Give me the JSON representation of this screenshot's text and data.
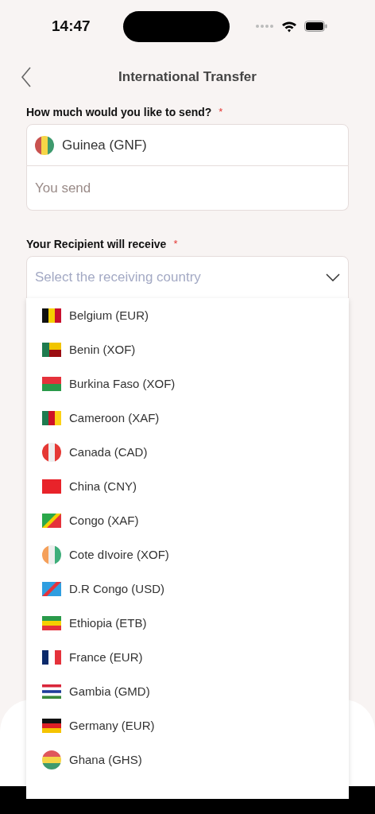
{
  "status_bar": {
    "time": "14:47"
  },
  "header": {
    "title": "International Transfer"
  },
  "send": {
    "label": "How much would you like to send?",
    "required_mark": "*",
    "currency": {
      "name": "Guinea (GNF)"
    },
    "amount": {
      "placeholder": "You send"
    }
  },
  "receive": {
    "label": "Your Recipient will receive",
    "required_mark": "*",
    "select": {
      "placeholder": "Select the receiving country",
      "expanded": true
    }
  },
  "countries": [
    {
      "name": "Belgium (EUR)"
    },
    {
      "name": "Benin (XOF)"
    },
    {
      "name": "Burkina Faso (XOF)"
    },
    {
      "name": "Cameroon (XAF)"
    },
    {
      "name": "Canada (CAD)"
    },
    {
      "name": "China (CNY)"
    },
    {
      "name": "Congo (XAF)"
    },
    {
      "name": "Cote dIvoire (XOF)"
    },
    {
      "name": "D.R Congo (USD)"
    },
    {
      "name": "Ethiopia (ETB)"
    },
    {
      "name": "France (EUR)"
    },
    {
      "name": "Gambia (GMD)"
    },
    {
      "name": "Germany (EUR)"
    },
    {
      "name": "Ghana (GHS)"
    }
  ]
}
